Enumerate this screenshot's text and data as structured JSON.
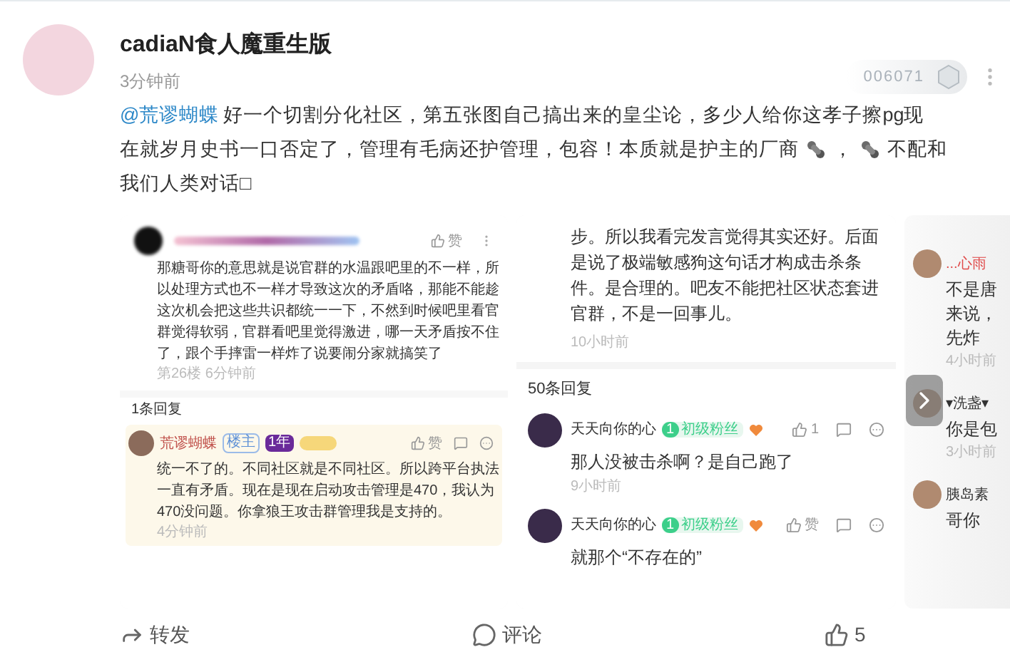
{
  "author": {
    "name": "cadiaN食人魔重生版",
    "time": "3分钟前",
    "badge_number": "006071"
  },
  "post": {
    "lines": [
      [
        {
          "kind": "mention",
          "text": "@荒谬蝴蝶"
        },
        {
          "kind": "text",
          "text": "好一个切割分化社区，第五张图自己搞出来的皇尘论，多少人给你这孝子擦pg现"
        }
      ],
      [
        {
          "kind": "text",
          "text": "在就岁月史书一口否定了，管理有毛病还护管理，包容！本质就是护主的厂商"
        },
        {
          "kind": "emoji"
        },
        {
          "kind": "text",
          "text": "，"
        },
        {
          "kind": "emoji"
        },
        {
          "kind": "text",
          "text": "不配和"
        }
      ],
      [
        {
          "kind": "text",
          "text": "我们人类对话□"
        }
      ]
    ]
  },
  "gallery": [
    {
      "kind": "thread",
      "like_label": "赞",
      "comment": "那糖哥你的意思就是说官群的水温跟吧里的不一样，所以处理方式也不一样才导致这次的矛盾咯，那能不能趁这次机会把这些共识都统一一下，不然到时候吧里看官群觉得软弱，官群看吧里觉得激进，哪一天矛盾按不住了，跟个手摔雷一样炸了说要闹分家就搞笑了",
      "meta": "第26楼 6分钟前",
      "reply_count": "1条回复",
      "reply": {
        "name": "荒谬蝴蝶",
        "tags": [
          "楼主",
          "1年"
        ],
        "like_label": "赞",
        "text": "统一不了的。不同社区就是不同社区。所以跨平台执法一直有矛盾。现在是现在启动攻击管理是470，我认为470没问题。你拿狼王攻击群管理我是支持的。",
        "time": "4分钟前"
      }
    },
    {
      "kind": "replies",
      "comment": "步。所以我看完发言觉得其实还好。后面是说了极端敏感狗这句话才构成击杀条件。是合理的。吧友不能把社区状态套进官群，不是一回事儿。",
      "time": "10小时前",
      "reply_count": "50条回复",
      "replies": [
        {
          "name": "天天向你的心",
          "level": "1",
          "tag": "初级粉丝",
          "likes": "1",
          "text": "那人没被击杀啊？是自己跑了",
          "time": "9小时前"
        },
        {
          "name": "天天向你的心",
          "level": "1",
          "tag": "初级粉丝",
          "likes": "赞",
          "text": "就那个“不存在的”"
        }
      ]
    },
    {
      "kind": "partial",
      "items": [
        {
          "name": "...心雨",
          "lines": [
            "不是唐",
            "来说，",
            "先炸"
          ],
          "time": "4小时前"
        },
        {
          "name": "▾洗盏▾",
          "lines": [
            "你是包"
          ],
          "time": "3小时前"
        },
        {
          "name": "胰岛素",
          "lines": [
            "哥你"
          ]
        }
      ]
    }
  ],
  "actions": [
    {
      "kind": "share",
      "label": "转发"
    },
    {
      "kind": "comment",
      "label": "评论"
    },
    {
      "kind": "like",
      "label": "5"
    }
  ]
}
